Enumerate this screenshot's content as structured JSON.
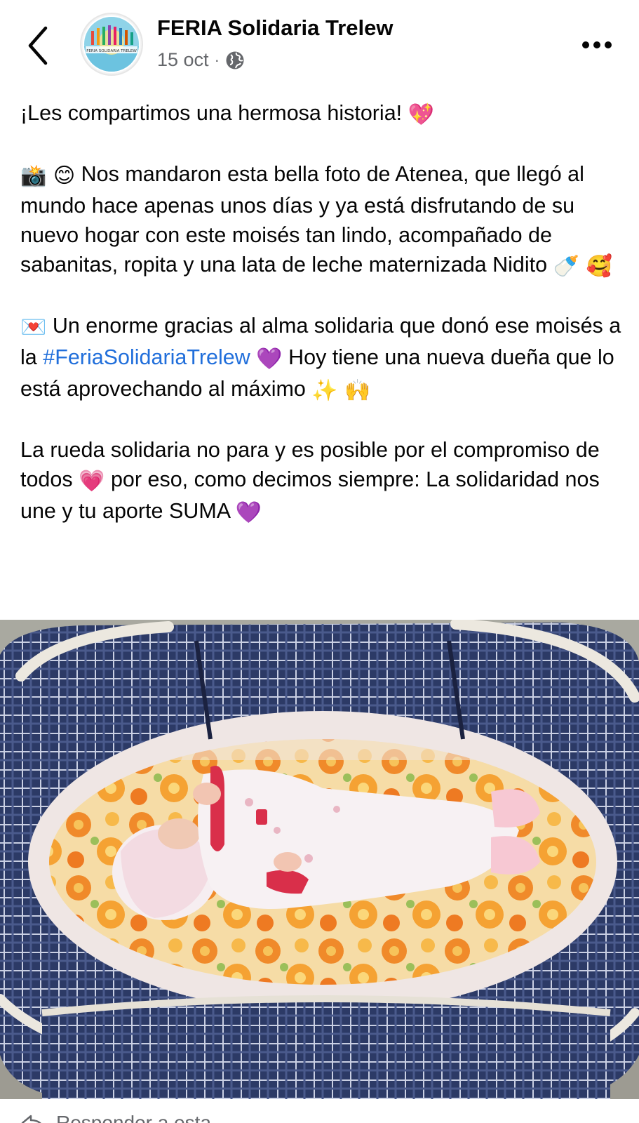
{
  "header": {
    "back_icon": "chevron-left-icon",
    "page_name": "FERIA Solidaria Trelew",
    "date": "15 oct",
    "separator": "·",
    "audience_icon": "globe-icon",
    "more_icon": "more-horizontal-icon",
    "avatar_text": "FERIA SOLIDARIA TRELEW"
  },
  "post": {
    "p1": {
      "text": "¡Les compartimos una hermosa historia!",
      "emoji": "💖"
    },
    "p2": {
      "emoji_lead": "📸 😊",
      "text": "Nos mandaron esta bella foto de Atenea, que llegó al mundo hace apenas unos días y ya está disfrutando de su nuevo hogar con este moisés tan lindo, acompañado de sabanitas, ropita y una lata de leche maternizada Nidito",
      "emoji_tail": "🍼 🥰"
    },
    "p3": {
      "emoji_lead": "💌",
      "text_a": "Un enorme gracias al alma solidaria que donó ese moisés a la",
      "hashtag": "#FeriaSolidariaTrelew",
      "emoji_mid": "💜",
      "text_b": "Hoy tiene una nueva dueña que lo está aprovechando al máximo",
      "emoji_tail": "✨ 🙌"
    },
    "p4": {
      "text_a": "La rueda solidaria no para y es posible por el compromiso de todos",
      "emoji_mid": "💗",
      "text_b": "por eso, como decimos siempre: La solidaridad nos une y tu aporte SUMA",
      "emoji_tail": "💜"
    }
  },
  "footer": {
    "share_icon": "share-icon",
    "share_text": "Responder a esta..."
  },
  "colors": {
    "text_primary": "#050505",
    "text_secondary": "#65676b",
    "link": "#216fdb"
  }
}
